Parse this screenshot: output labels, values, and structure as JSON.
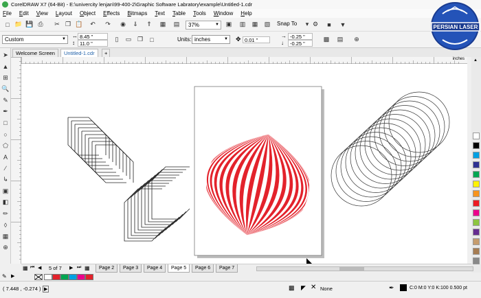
{
  "window": {
    "title": "CorelDRAW X7 (64-Bit) - E:\\univercity lenjan\\99-400-2\\Graphic Software Labratory\\example\\Untitled-1.cdr"
  },
  "menu": [
    "File",
    "Edit",
    "View",
    "Layout",
    "Object",
    "Effects",
    "Bitmaps",
    "Text",
    "Table",
    "Tools",
    "Window",
    "Help"
  ],
  "toolbar": {
    "zoom": "37%",
    "snap_to": "Snap To"
  },
  "property_bar": {
    "page_preset": "Custom",
    "width": "8.45 \"",
    "height": "11.0 \"",
    "units_label": "Units:",
    "units_value": "inches",
    "nudge": "0.01 \"",
    "dup_x": "-0.25 \"",
    "dup_y": "-0.25 \""
  },
  "doc_tabs": [
    "Welcome Screen",
    "Untitled-1.cdr"
  ],
  "ruler": {
    "units": "inches"
  },
  "page_nav": {
    "current": "5 of 7",
    "pages": [
      "Page 2",
      "Page 3",
      "Page 4",
      "Page 5",
      "Page 6",
      "Page 7"
    ],
    "active": "Page 5"
  },
  "status": {
    "coords": "( 7.448 , -0.274 )",
    "fill": "None",
    "outline": "C:0 M:0 Y:0 K:100  0.500 pt"
  },
  "logo": {
    "text": "PERSIAN LASER"
  },
  "colors": {
    "red": "#e3222b",
    "palette": [
      "#ffffff",
      "#000000",
      "#00a0e3",
      "#2e3192",
      "#00a651",
      "#fff200",
      "#f7941d",
      "#ed1c24",
      "#ec008c",
      "#8dc63f",
      "#662d91",
      "#c69c6d",
      "#a67c52",
      "#898989"
    ]
  },
  "bottom_colors": [
    "#ffffff",
    "#e3222b",
    "#00a651",
    "#00a0e3",
    "#ec008c",
    "#e3222b"
  ]
}
